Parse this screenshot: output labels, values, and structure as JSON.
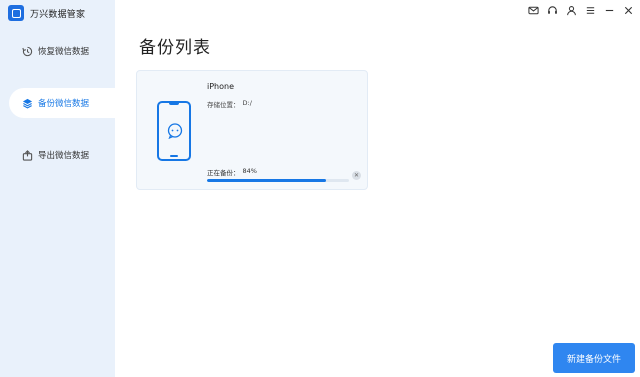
{
  "app": {
    "title": "万兴数据管家"
  },
  "sidebar": {
    "items": [
      {
        "label": "恢复微信数据",
        "icon": "restore-icon"
      },
      {
        "label": "备份微信数据",
        "icon": "layers-icon",
        "active": true
      },
      {
        "label": "导出微信数据",
        "icon": "export-icon"
      }
    ]
  },
  "topbar": {
    "icons": [
      "mail-icon",
      "headset-icon",
      "user-icon",
      "menu-icon",
      "minimize-icon",
      "close-icon"
    ]
  },
  "main": {
    "title": "备份列表",
    "card": {
      "device_name": "iPhone",
      "storage_label": "存储位置：",
      "storage_value": "D:/",
      "progress_label": "正在备份：",
      "progress_value": "84%",
      "progress_fraction": 0.84
    },
    "new_backup_button": "新建备份文件"
  },
  "colors": {
    "accent": "#1677e5",
    "sidebar_bg": "#e9f1fb",
    "button_bg": "#2f86f0"
  }
}
